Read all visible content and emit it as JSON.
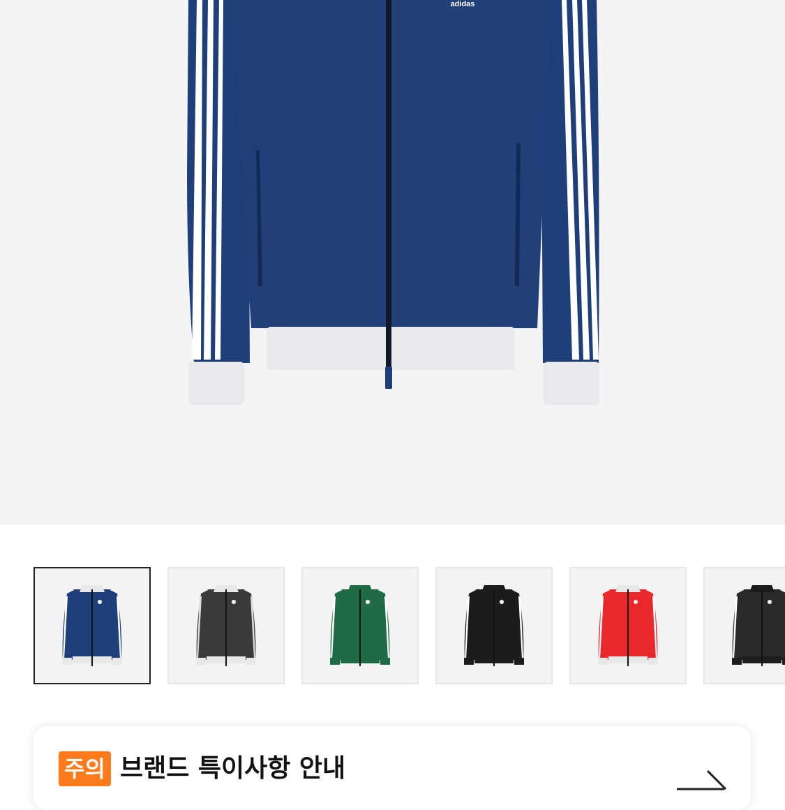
{
  "hero": {
    "product_image": "navy-track-jacket-photo",
    "logo_text": "adidas"
  },
  "thumbnails": [
    {
      "color": "#1f3f7a",
      "collar": "#e8e8e8",
      "stripes": "#ffffff",
      "cuffs": "#e8e8e8",
      "selected": true
    },
    {
      "color": "#3a3a3a",
      "collar": "#e8e8e8",
      "stripes": "#dddddd",
      "cuffs": "#e8e8e8",
      "selected": false
    },
    {
      "color": "#1e6b45",
      "collar": "#1e6b45",
      "stripes": "#ffffff",
      "cuffs": "#1e6b45",
      "selected": false
    },
    {
      "color": "#1c1c1c",
      "collar": "#1c1c1c",
      "stripes": "#ffffff",
      "cuffs": "#1c1c1c",
      "selected": false
    },
    {
      "color": "#e8282b",
      "collar": "#e8e8e8",
      "stripes": "#ffffff",
      "cuffs": "#e8e8e8",
      "selected": false
    },
    {
      "color": "#2a2a2a",
      "collar": "#1c1c1c",
      "stripes": "#ffffff",
      "cuffs": "#1c1c1c",
      "selected": false
    }
  ],
  "notice": {
    "badge": "주의",
    "title": "브랜드 특이사항 안내",
    "arrow_icon": "arrow-right-icon"
  },
  "colors": {
    "badge_orange": "#ff7a1a",
    "jacket_navy": "#1f3f7a"
  }
}
